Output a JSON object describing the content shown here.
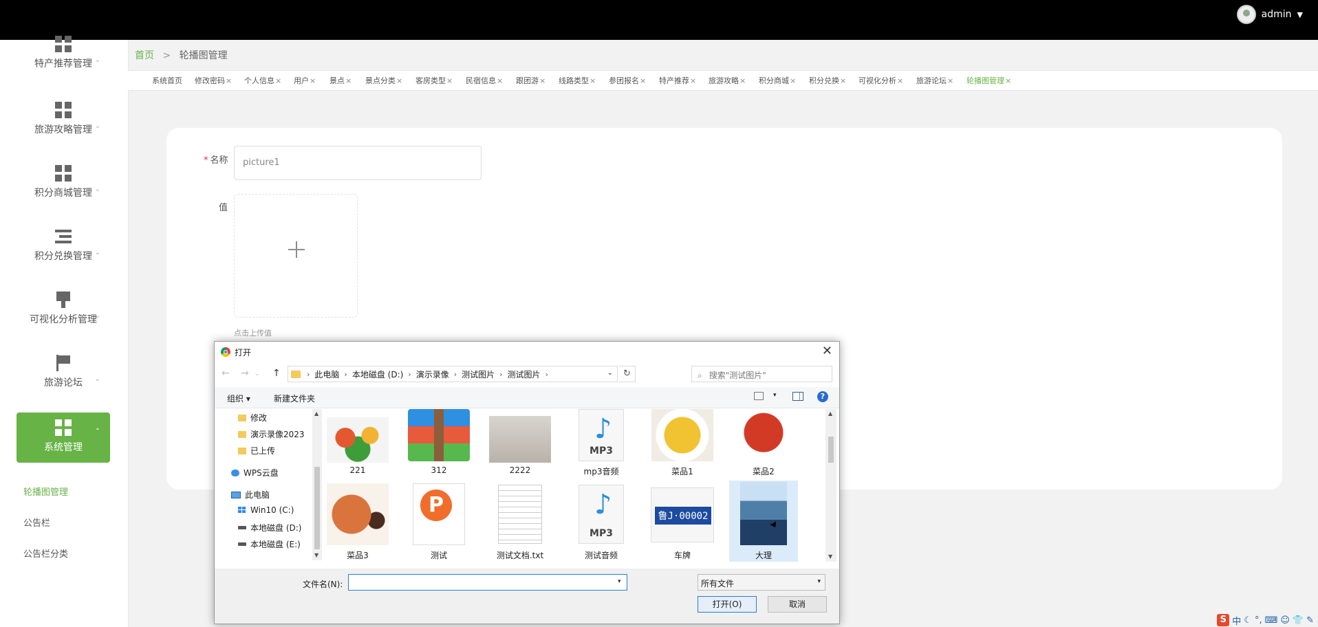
{
  "header": {
    "username": "admin",
    "caret": "▼"
  },
  "sidebar": {
    "items": [
      {
        "label": "特产推荐管理",
        "icon": "grid-icon"
      },
      {
        "label": "旅游攻略管理",
        "icon": "grid-icon"
      },
      {
        "label": "积分商城管理",
        "icon": "grid-icon"
      },
      {
        "label": "积分兑换管理",
        "icon": "list-indent-icon"
      },
      {
        "label": "可视化分析管理",
        "icon": "brush-icon"
      },
      {
        "label": "旅游论坛",
        "icon": "flag-icon"
      },
      {
        "label": "系统管理",
        "icon": "grid-icon",
        "active": true
      }
    ],
    "submenu": [
      "轮播图管理",
      "公告栏",
      "公告栏分类"
    ]
  },
  "breadcrumb": {
    "home": "首页",
    "separator": ">",
    "current": "轮播图管理"
  },
  "tabs": [
    "系统首页",
    "修改密码",
    "个人信息",
    "用户",
    "景点",
    "景点分类",
    "客房类型",
    "民宿信息",
    "跟团游",
    "线路类型",
    "参团报名",
    "特产推荐",
    "旅游攻略",
    "积分商城",
    "积分兑换",
    "可视化分析",
    "旅游论坛",
    "轮播图管理"
  ],
  "tab_close": "×",
  "form": {
    "required_mark": "*",
    "name_label": "名称",
    "name_value": "picture1",
    "value_label": "值",
    "upload_hint": "点击上传值"
  },
  "dialog": {
    "title": "打开",
    "close": "✕",
    "path": [
      "此电脑",
      "本地磁盘 (D:)",
      "演示录像",
      "测试图片",
      "测试图片"
    ],
    "search_placeholder": "搜索\"测试图片\"",
    "toolbar": {
      "organize": "组织 ▾",
      "new_folder": "新建文件夹",
      "help": "?"
    },
    "tree": [
      {
        "label": "修改",
        "icon": "folder-icon"
      },
      {
        "label": "演示录像2023",
        "icon": "folder-icon"
      },
      {
        "label": "已上传",
        "icon": "folder-icon"
      },
      {
        "label": "WPS云盘",
        "icon": "cloud-icon"
      },
      {
        "label": "此电脑",
        "icon": "computer-icon"
      },
      {
        "label": "Win10 (C:)",
        "icon": "windows-drive-icon"
      },
      {
        "label": "本地磁盘 (D:)",
        "icon": "drive-icon",
        "selected": true
      },
      {
        "label": "本地磁盘 (E:)",
        "icon": "drive-icon"
      }
    ],
    "files": [
      {
        "name": "221",
        "kind": "image-vegetables"
      },
      {
        "name": "312",
        "kind": "archive"
      },
      {
        "name": "2222",
        "kind": "image-bottles"
      },
      {
        "name": "mp3音频",
        "kind": "audio"
      },
      {
        "name": "菜品1",
        "kind": "image-food"
      },
      {
        "name": "菜品2",
        "kind": "image-food"
      },
      {
        "name": "菜品3",
        "kind": "image-food"
      },
      {
        "name": "测试",
        "kind": "ppt"
      },
      {
        "name": "测试文档.txt",
        "kind": "text"
      },
      {
        "name": "测试音频",
        "kind": "audio"
      },
      {
        "name": "车牌",
        "kind": "image-plate"
      },
      {
        "name": "大理",
        "kind": "image-sea",
        "selected": true
      }
    ],
    "mp3_label": "MP3",
    "plate_text": "鲁J·00002",
    "ppt_letter": "P",
    "filename_label": "文件名(N):",
    "filename_value": "",
    "filetype": "所有文件",
    "open_button": "打开(O)",
    "cancel_button": "取消"
  },
  "tray": {
    "ime": "中",
    "logo": "S"
  },
  "colors": {
    "accent": "#67b346",
    "topbar": "#000000",
    "dialog_focus": "#2b7ad6"
  }
}
